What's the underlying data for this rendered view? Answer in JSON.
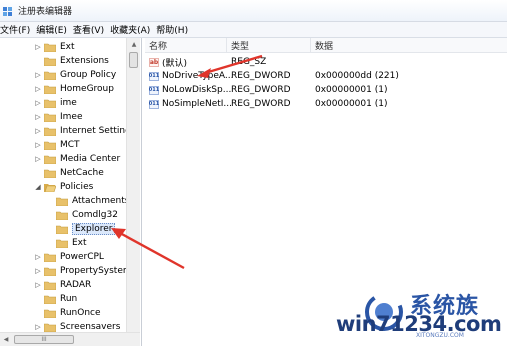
{
  "window": {
    "title": "注册表编辑器"
  },
  "menu": [
    "文件(F)",
    "编辑(E)",
    "查看(V)",
    "收藏夹(A)",
    "帮助(H)"
  ],
  "tree": {
    "items": [
      {
        "label": "Ext",
        "expander": "▷"
      },
      {
        "label": "Extensions",
        "expander": ""
      },
      {
        "label": "Group Policy",
        "expander": "▷"
      },
      {
        "label": "HomeGroup",
        "expander": "▷"
      },
      {
        "label": "ime",
        "expander": "▷"
      },
      {
        "label": "Imee",
        "expander": "▷"
      },
      {
        "label": "Internet Settings",
        "expander": "▷"
      },
      {
        "label": "MCT",
        "expander": "▷"
      },
      {
        "label": "Media Center",
        "expander": "▷"
      },
      {
        "label": "NetCache",
        "expander": ""
      },
      {
        "label": "Policies",
        "expander": "◢"
      },
      {
        "label": "Attachments",
        "expander": ""
      },
      {
        "label": "Comdlg32",
        "expander": ""
      },
      {
        "label": "Explorer",
        "expander": ""
      },
      {
        "label": "Ext",
        "expander": "▷"
      },
      {
        "label": "PowerCPL",
        "expander": "▷"
      },
      {
        "label": "PropertySystem",
        "expander": "▷"
      },
      {
        "label": "RADAR",
        "expander": "▷"
      },
      {
        "label": "Run",
        "expander": ""
      },
      {
        "label": "RunOnce",
        "expander": ""
      },
      {
        "label": "Screensavers",
        "expander": "▷"
      }
    ],
    "selected": "Explorer",
    "hscroll_thumb": "III"
  },
  "values_table": {
    "columns": [
      "名称",
      "类型",
      "数据"
    ],
    "rows": [
      {
        "icon": "string-value-icon",
        "glyph": "ab",
        "name": "(默认)",
        "type": "REG_SZ",
        "data": ""
      },
      {
        "icon": "dword-value-icon",
        "glyph": "011",
        "name": "NoDriveTypeA...",
        "type": "REG_DWORD",
        "data": "0x000000dd (221)"
      },
      {
        "icon": "dword-value-icon",
        "glyph": "011",
        "name": "NoLowDiskSp...",
        "type": "REG_DWORD",
        "data": "0x00000001 (1)"
      },
      {
        "icon": "dword-value-icon",
        "glyph": "011",
        "name": "NoSimpleNetI...",
        "type": "REG_DWORD",
        "data": "0x00000001 (1)"
      }
    ]
  },
  "watermark": {
    "text": "win71234.com",
    "brand": "系统族",
    "url": "XITONGZU.COM"
  },
  "colors": {
    "arrow": "#e0352b",
    "selection": "#dbe8fb",
    "folder": "#e8c16a"
  }
}
